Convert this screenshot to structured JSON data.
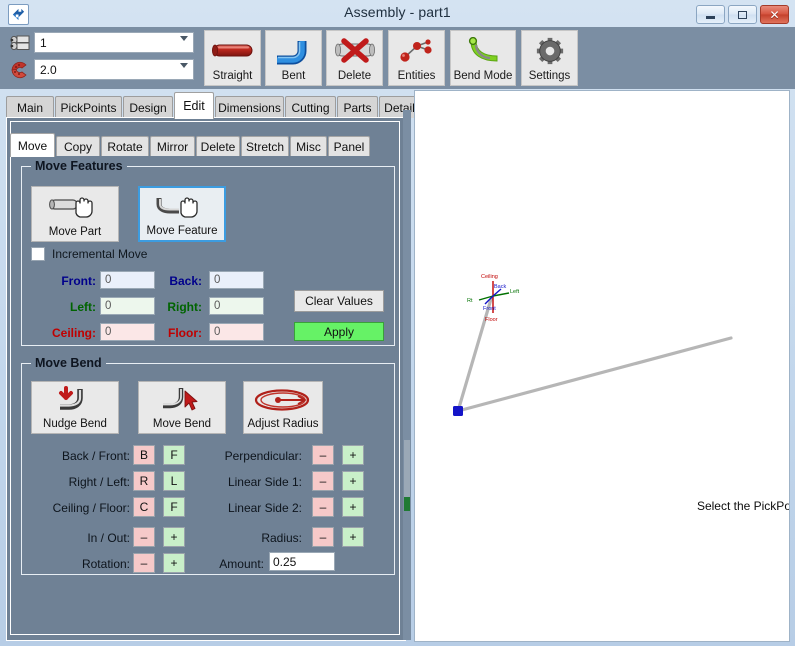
{
  "window": {
    "title": "Assembly - part1",
    "app_icon": "app-logo-icon",
    "minimize": "minimize-icon",
    "maximize": "maximize-icon",
    "close": "close-icon"
  },
  "toolbar": {
    "combos": [
      {
        "icon": "pipe-segment-icon",
        "value": "1"
      },
      {
        "icon": "bend-die-icon",
        "value": "2.0"
      }
    ],
    "buttons": [
      {
        "label": "Straight",
        "icon": "straight-tube-icon"
      },
      {
        "label": "Bent",
        "icon": "bent-tube-icon"
      },
      {
        "label": "Delete",
        "icon": "delete-x-icon"
      },
      {
        "label": "Entities",
        "icon": "entities-nodes-icon"
      },
      {
        "label": "Bend Mode",
        "icon": "bend-mode-icon"
      },
      {
        "label": "Settings",
        "icon": "gear-icon"
      }
    ]
  },
  "tabs": {
    "selected": "Edit",
    "items": [
      "Main",
      "PickPoints",
      "Design",
      "Edit",
      "Dimensions",
      "Cutting",
      "Parts",
      "Details"
    ]
  },
  "subtabs": {
    "selected": "Move",
    "items": [
      "Move",
      "Copy",
      "Rotate",
      "Mirror",
      "Delete",
      "Stretch",
      "Misc",
      "Panel"
    ]
  },
  "move_features": {
    "title": "Move Features",
    "move_part": {
      "label": "Move Part",
      "icon": "move-part-hand-icon"
    },
    "move_feature": {
      "label": "Move Feature",
      "icon": "move-feature-hand-icon",
      "selected": true
    },
    "incremental": {
      "label": "Incremental Move",
      "checked": false
    },
    "fields": [
      {
        "label": "Front:",
        "value": "0",
        "color": "#00008B",
        "bg": "#eaf0fb"
      },
      {
        "label": "Back:",
        "value": "0",
        "color": "#00008B",
        "bg": "#eaf0fb"
      },
      {
        "label": "Left:",
        "value": "0",
        "color": "#006400",
        "bg": "#edf7ed"
      },
      {
        "label": "Right:",
        "value": "0",
        "color": "#006400",
        "bg": "#edf7ed"
      },
      {
        "label": "Ceiling:",
        "value": "0",
        "color": "#C00000",
        "bg": "#fbe7e7"
      },
      {
        "label": "Floor:",
        "value": "0",
        "color": "#C00000",
        "bg": "#fbe7e7"
      }
    ],
    "clear_button": "Clear Values",
    "apply_button": "Apply",
    "apply_color": "#66F266"
  },
  "move_bend": {
    "title": "Move Bend",
    "buttons": [
      {
        "label": "Nudge Bend",
        "icon": "nudge-bend-icon"
      },
      {
        "label": "Move Bend",
        "icon": "move-bend-cursor-icon"
      },
      {
        "label": "Adjust Radius",
        "icon": "adjust-radius-icon"
      }
    ],
    "left_rows": [
      {
        "label": "Back / Front:",
        "neg": "B",
        "pos": "F"
      },
      {
        "label": "Right / Left:",
        "neg": "R",
        "pos": "L"
      },
      {
        "label": "Ceiling / Floor:",
        "neg": "C",
        "pos": "F"
      },
      {
        "label": "In / Out:",
        "neg": "–",
        "pos": "+"
      },
      {
        "label": "Rotation:",
        "neg": "–",
        "pos": "+"
      }
    ],
    "right_rows": [
      {
        "label": "Perpendicular:",
        "neg": "–",
        "pos": "+"
      },
      {
        "label": "Linear Side 1:",
        "neg": "–",
        "pos": "+"
      },
      {
        "label": "Linear Side 2:",
        "neg": "–",
        "pos": "+"
      }
    ],
    "radius_row": {
      "label": "Radius:",
      "neg": "–",
      "pos": "+"
    },
    "amount": {
      "label": "Amount:",
      "value": "0.25"
    }
  },
  "viewport": {
    "status_text": "Select the PickPo",
    "gizmo": {
      "origin_label": "Ceiling",
      "floor_label": "Floor",
      "left_label": "Left",
      "right_label": "Rt",
      "back_label": "Back",
      "front_label": "Front"
    }
  },
  "colors": {
    "panel_bg": "#6f8195",
    "toolbar_bg": "#7b8ea3",
    "accent_select": "#3c9ce0",
    "node_blue": "#1414c8",
    "tube_gray": "#b4b4b4"
  }
}
